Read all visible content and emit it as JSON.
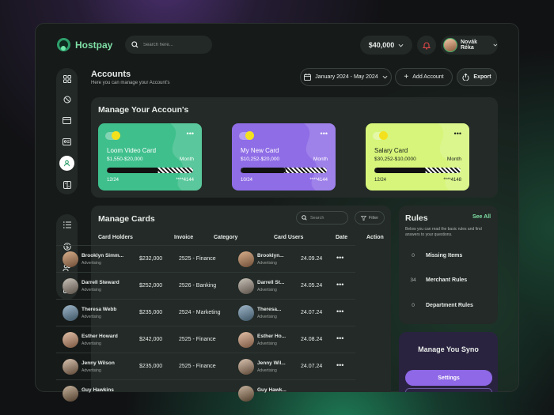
{
  "header": {
    "logo_text": "Hostpay",
    "search_placeholder": "Search here...",
    "balance": "$40,000",
    "user_name": "Novák Réka"
  },
  "sidebar": {
    "top_icons": [
      "grid-icon",
      "no-money-icon",
      "card-icon",
      "id-card-icon",
      "user-icon",
      "calculator-icon"
    ],
    "active_index": 4,
    "bottom_icons": [
      "list-icon",
      "dollar-icon",
      "users-icon",
      "document-icon"
    ]
  },
  "accounts": {
    "title": "Accounts",
    "subtitle": "Here you can manage your Account's",
    "date_range": "January 2024 - May 2024",
    "add_label": "Add Account",
    "export_label": "Export"
  },
  "manage_accounts": {
    "title": "Manage Your Accoun's",
    "cards": [
      {
        "name": "Loom Video Card",
        "range": "$1,550-$20,000",
        "period": "Month",
        "progress": "12/24",
        "masked": "****4144",
        "progress_fraction": 0.6,
        "color": "#3fbf8c",
        "text_color": "#ffffff"
      },
      {
        "name": "My New Card",
        "range": "$10,252-$20,000",
        "period": "Month",
        "progress": "10/24",
        "masked": "****4144",
        "progress_fraction": 0.52,
        "color": "#8f6de6",
        "text_color": "#ffffff"
      },
      {
        "name": "Salary Card",
        "range": "$30,252-$10,0000",
        "period": "Month",
        "progress": "12/24",
        "masked": "****4148",
        "progress_fraction": 0.6,
        "color": "#d6f57a",
        "text_color": "#1b1f1d"
      }
    ]
  },
  "manage_cards": {
    "title": "Manage Cards",
    "search_placeholder": "Search",
    "filter_label": "Filter",
    "columns": [
      "Card Holders",
      "Invoice",
      "Category",
      "Card Users",
      "Date",
      "Action"
    ],
    "rows": [
      {
        "holder": "Brooklyn Simm...",
        "holder_tag": "Advertising",
        "invoice": "$232,000",
        "category": "2525 - Finance",
        "user": "Brooklyn...",
        "user_tag": "Advertising",
        "date": "24.09.24"
      },
      {
        "holder": "Darrell Steward",
        "holder_tag": "Advertising",
        "invoice": "$252,000",
        "category": "2526 - Banking",
        "user": "Darrell St...",
        "user_tag": "Advertising",
        "date": "24.05.24"
      },
      {
        "holder": "Theresa Webb",
        "holder_tag": "Advertising",
        "invoice": "$235,000",
        "category": "2524 - Marketing",
        "user": "Theresa...",
        "user_tag": "Advertising",
        "date": "24.07.24"
      },
      {
        "holder": "Esther Howard",
        "holder_tag": "Advertising",
        "invoice": "$242,000",
        "category": "2525 - Finance",
        "user": "Esther Ho...",
        "user_tag": "Advertising",
        "date": "24.08.24"
      },
      {
        "holder": "Jenny Wilson",
        "holder_tag": "Advertising",
        "invoice": "$235,000",
        "category": "2525 - Finance",
        "user": "Jenny Wil...",
        "user_tag": "Advertising",
        "date": "24.07.24"
      },
      {
        "holder": "Guy Hawkins",
        "holder_tag": "",
        "invoice": "",
        "category": "",
        "user": "Guy Hawk...",
        "user_tag": "",
        "date": ""
      }
    ],
    "action_symbol": "•••"
  },
  "rules": {
    "title": "Rules",
    "see_all": "See All",
    "subtitle": "Below you can read the basic rules and find answers to your questions.",
    "items": [
      {
        "count": "0",
        "label": "Missing Items"
      },
      {
        "count": "34",
        "label": "Merchant Rules"
      },
      {
        "count": "0",
        "label": "Department Rules"
      }
    ]
  },
  "sync": {
    "title": "Manage You Syno",
    "settings_label": "Settings"
  }
}
